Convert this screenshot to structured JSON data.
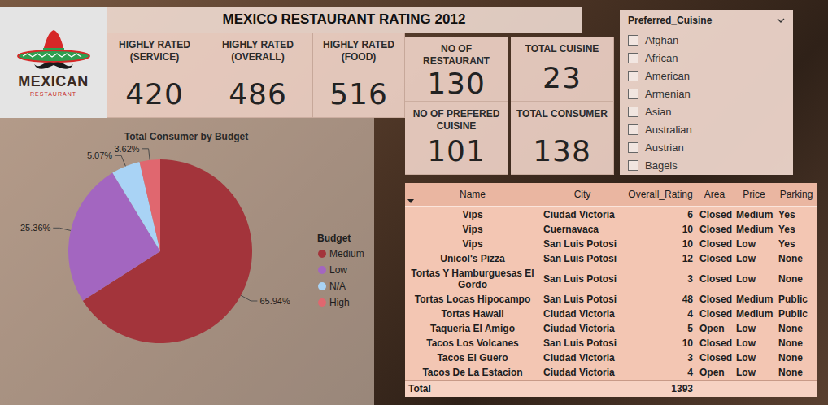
{
  "title": "MEXICO RESTAURANT RATING 2012",
  "logo": {
    "name": "MEXICAN",
    "tagline": "RESTAURANT"
  },
  "highly_rated_cards": [
    {
      "label": "HIGHLY RATED (SERVICE)",
      "value": "420"
    },
    {
      "label": "HIGHLY RATED (OVERALL)",
      "value": "486"
    },
    {
      "label": "HIGHLY RATED (FOOD)",
      "value": "516"
    }
  ],
  "kpi_cards": [
    {
      "label": "NO OF RESTAURANT",
      "value": "130"
    },
    {
      "label": "TOTAL CUISINE",
      "value": "23"
    },
    {
      "label": "NO OF PREFERED CUISINE",
      "value": "101"
    },
    {
      "label": "TOTAL CONSUMER",
      "value": "138"
    }
  ],
  "slicer": {
    "title": "Preferred_Cuisine",
    "items": [
      {
        "label": "Afghan",
        "checked": false
      },
      {
        "label": "African",
        "checked": false
      },
      {
        "label": "American",
        "checked": false
      },
      {
        "label": "Armenian",
        "checked": false
      },
      {
        "label": "Asian",
        "checked": false
      },
      {
        "label": "Australian",
        "checked": false
      },
      {
        "label": "Austrian",
        "checked": false
      },
      {
        "label": "Bagels",
        "checked": false
      }
    ]
  },
  "pie_chart": {
    "title": "Total Consumer by Budget",
    "legend_title": "Budget",
    "series": [
      {
        "name": "Medium",
        "value": 65.94,
        "label": "65.94%",
        "color": "#a3343b"
      },
      {
        "name": "Low",
        "value": 25.36,
        "label": "25.36%",
        "color": "#a366c0"
      },
      {
        "name": "N/A",
        "value": 5.07,
        "label": "5.07%",
        "color": "#a9d3f5"
      },
      {
        "name": "High",
        "value": 3.62,
        "label": "3.62%",
        "color": "#e0676f"
      }
    ]
  },
  "table": {
    "columns": [
      "Name",
      "City",
      "Overall_Rating",
      "Area",
      "Price",
      "Parking"
    ],
    "rows": [
      [
        "Vips",
        "Ciudad Victoria",
        "6",
        "Closed",
        "Medium",
        "Yes"
      ],
      [
        "Vips",
        "Cuernavaca",
        "10",
        "Closed",
        "Medium",
        "Yes"
      ],
      [
        "Vips",
        "San Luis Potosi",
        "10",
        "Closed",
        "Low",
        "Yes"
      ],
      [
        "Unicol's Pizza",
        "San Luis Potosi",
        "12",
        "Closed",
        "Low",
        "None"
      ],
      [
        "Tortas Y Hamburguesas El Gordo",
        "San Luis Potosi",
        "3",
        "Closed",
        "Low",
        "None"
      ],
      [
        "Tortas Locas Hipocampo",
        "San Luis Potosi",
        "48",
        "Closed",
        "Medium",
        "Public"
      ],
      [
        "Tortas Hawaii",
        "Ciudad Victoria",
        "4",
        "Closed",
        "Medium",
        "Public"
      ],
      [
        "Taqueria El Amigo",
        "Ciudad Victoria",
        "5",
        "Open",
        "Low",
        "None"
      ],
      [
        "Tacos Los Volcanes",
        "San Luis Potosi",
        "10",
        "Closed",
        "Low",
        "None"
      ],
      [
        "Tacos El Guero",
        "Ciudad Victoria",
        "3",
        "Closed",
        "Low",
        "None"
      ],
      [
        "Tacos De La Estacion",
        "Ciudad Victoria",
        "4",
        "Open",
        "Low",
        "None"
      ]
    ],
    "total": {
      "label": "Total",
      "overall_rating": "1393"
    }
  }
}
